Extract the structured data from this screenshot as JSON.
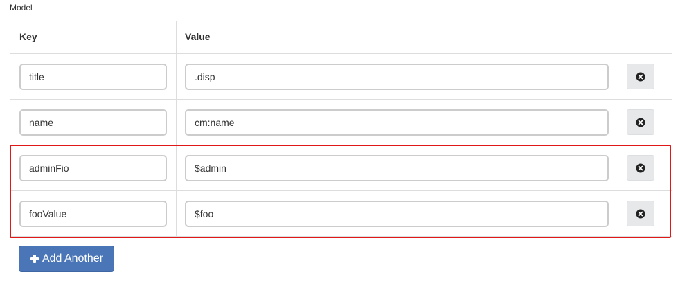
{
  "section_label": "Model",
  "columns": {
    "key": "Key",
    "value": "Value"
  },
  "rows": [
    {
      "key": "title",
      "value": ".disp"
    },
    {
      "key": "name",
      "value": "cm:name"
    },
    {
      "key": "adminFio",
      "value": "$admin"
    },
    {
      "key": "fooValue",
      "value": "$foo"
    }
  ],
  "add_button_label": "Add Another",
  "icons": {
    "remove": "times-circle-icon",
    "add": "plus-icon"
  },
  "highlight_color": "#e01818",
  "accent_color": "#4a76b8"
}
